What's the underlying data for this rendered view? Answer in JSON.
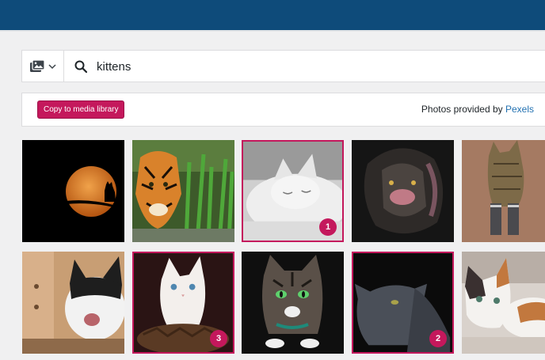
{
  "search": {
    "type_icon": "image-gallery-icon",
    "query": "kittens"
  },
  "toolbar": {
    "copy_label": "Copy to media library",
    "credit_prefix": "Photos provided by",
    "credit_link": "Pexels"
  },
  "colors": {
    "top_bar": "#0e4b7a",
    "accent": "#c4185c",
    "link": "#2271b1"
  },
  "results": [
    {
      "name": "moon-cat-silhouette",
      "selected": false,
      "order": ""
    },
    {
      "name": "tiger-in-grass",
      "selected": false,
      "order": ""
    },
    {
      "name": "sleeping-white-cat",
      "selected": true,
      "order": "1"
    },
    {
      "name": "lion-portrait",
      "selected": false,
      "order": ""
    },
    {
      "name": "tabby-cat-standing",
      "selected": false,
      "order": ""
    },
    {
      "name": "yawning-cat",
      "selected": false,
      "order": ""
    },
    {
      "name": "white-kitten",
      "selected": true,
      "order": "3"
    },
    {
      "name": "tabby-green-eyes",
      "selected": false,
      "order": ""
    },
    {
      "name": "grey-cat-looking-up",
      "selected": true,
      "order": "2"
    },
    {
      "name": "lying-calico-cat",
      "selected": false,
      "order": ""
    }
  ]
}
